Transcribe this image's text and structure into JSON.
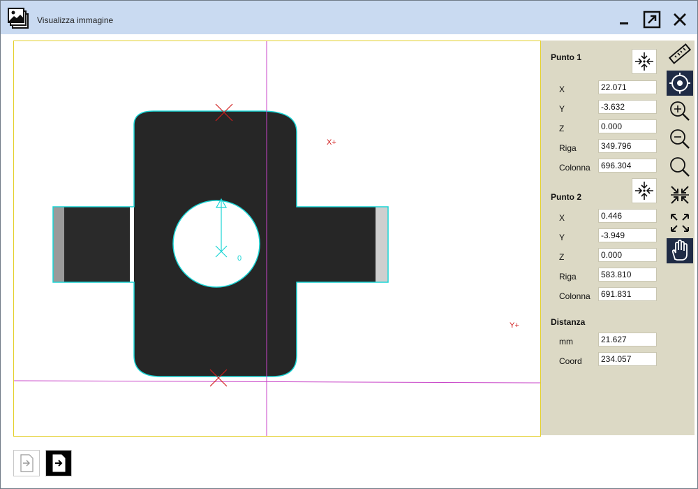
{
  "window": {
    "title": "Visualizza immagine"
  },
  "viewer": {
    "overlay_labels": {
      "x_plus": "X+",
      "y_plus": "Y+",
      "origin": "0"
    },
    "colors": {
      "contour": "#1ad5d5",
      "crosshair": "#c844c8",
      "marker": "#d11d1d",
      "frame": "#e3cf2a"
    }
  },
  "panel": {
    "punto1": {
      "title": "Punto 1",
      "x_label": "X",
      "x": "22.071",
      "y_label": "Y",
      "y": "-3.632",
      "z_label": "Z",
      "z": "0.000",
      "riga_label": "Riga",
      "riga": "349.796",
      "colonna_label": "Colonna",
      "colonna": "696.304"
    },
    "punto2": {
      "title": "Punto 2",
      "x_label": "X",
      "x": "0.446",
      "y_label": "Y",
      "y": "-3.949",
      "z_label": "Z",
      "z": "0.000",
      "riga_label": "Riga",
      "riga": "583.810",
      "colonna_label": "Colonna",
      "colonna": "691.831"
    },
    "distanza": {
      "title": "Distanza",
      "mm_label": "mm",
      "mm": "21.627",
      "coord_label": "Coord",
      "coord": "234.057"
    }
  },
  "toolbar": {
    "tools": [
      "ruler-icon",
      "target-icon",
      "zoom-in-icon",
      "zoom-out-icon",
      "zoom-icon",
      "shrink-icon",
      "expand-icon",
      "hand-icon"
    ],
    "active": [
      "target-icon",
      "hand-icon"
    ]
  },
  "bottom": {
    "buttons": [
      "import-button",
      "export-button"
    ]
  }
}
